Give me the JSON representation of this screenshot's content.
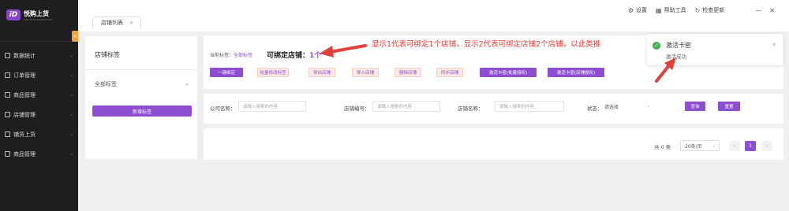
{
  "app": {
    "logo_mark": "iD",
    "name": "悦购上货",
    "subtitle": "YUE GOU SHANG HUO"
  },
  "sidebar": {
    "collapse_symbol": "«",
    "items": [
      {
        "label": "数据统计"
      },
      {
        "label": "订单管理"
      },
      {
        "label": "商品管理"
      },
      {
        "label": "店铺管理"
      },
      {
        "label": "铺货上货"
      },
      {
        "label": "商品管理"
      }
    ]
  },
  "topbar": {
    "actions": [
      {
        "icon": "gear-icon",
        "symbol": "⚙",
        "label": "设置"
      },
      {
        "icon": "tools-icon",
        "symbol": "▦",
        "label": "帮助工具"
      },
      {
        "icon": "refresh-icon",
        "symbol": "↻",
        "label": "检查更新"
      }
    ],
    "window": {
      "minimize": "—",
      "close": "✕"
    }
  },
  "tabs": [
    {
      "label": "店铺列表",
      "close": "✕"
    }
  ],
  "left_panel": {
    "title": "店铺标签",
    "select_value": "全部标签",
    "button": "新增标签"
  },
  "bind_info": {
    "current_label_prefix": "当前标签：",
    "current_label_value": "全部标签",
    "bind_label": "可绑定店铺：",
    "bind_count": "1个"
  },
  "annotation": "显示1代表可绑定1个店铺，显示2代表可绑定店铺2个店铺，以此类推",
  "action_buttons": [
    {
      "label": "一键绑定",
      "style": "fill"
    },
    {
      "label": "批量修改标签",
      "style": "light"
    },
    {
      "label": "导出店铺",
      "style": "light"
    },
    {
      "label": "导入店铺",
      "style": "light"
    },
    {
      "label": "删除店铺",
      "style": "light"
    },
    {
      "label": "同步店铺",
      "style": "light"
    },
    {
      "label": "激活卡密(批量授权)",
      "style": "fill"
    },
    {
      "label": "激活卡密(店铺授权)",
      "style": "fill"
    }
  ],
  "filters": {
    "company": {
      "label": "公司名称：",
      "placeholder": "请输入搜索的内容"
    },
    "store_no": {
      "label": "店铺编号：",
      "placeholder": "请输入搜索的内容"
    },
    "store_name": {
      "label": "店铺名称：",
      "placeholder": "请输入搜索的内容"
    },
    "status": {
      "label": "状态：",
      "value": "请选择"
    },
    "query_button": "查询",
    "reset_button": "重置"
  },
  "pager": {
    "total": "共 0 条",
    "page_size": "20条/页",
    "prev": "<",
    "current": "1",
    "next": ">"
  },
  "toast": {
    "title": "激活卡密",
    "message": "激活成功",
    "close": "✕"
  },
  "colors": {
    "accent": "#8e4ed1",
    "annotation": "#e2403a",
    "success": "#3fb24c",
    "collapse": "#f2a33a"
  }
}
